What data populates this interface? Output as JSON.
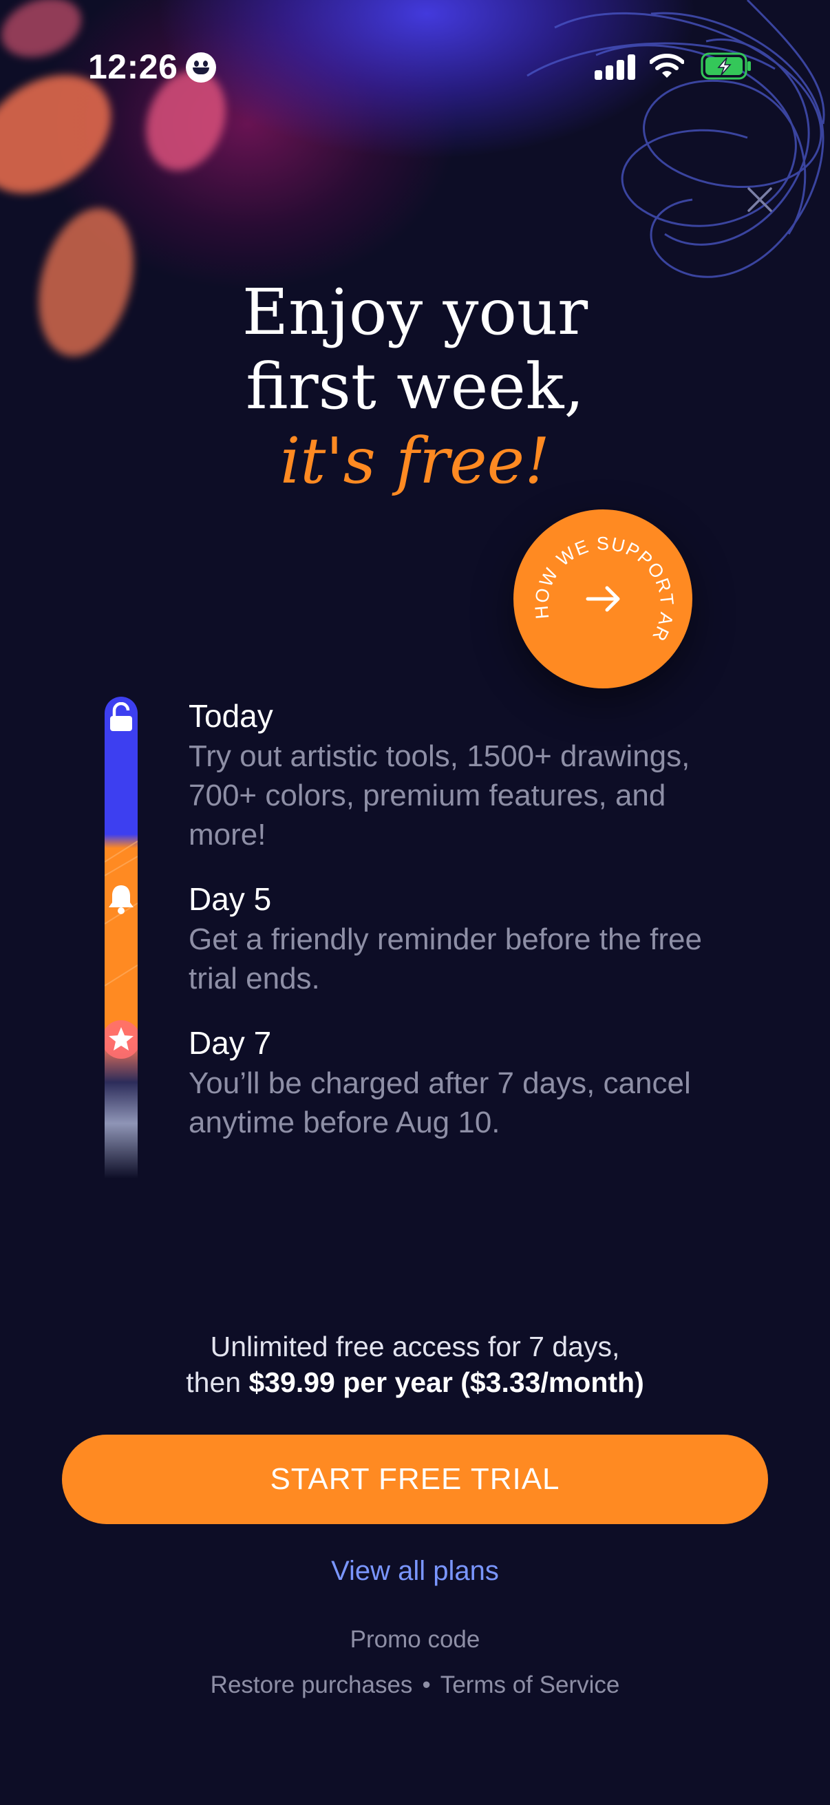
{
  "status_bar": {
    "time": "12:26"
  },
  "headline": {
    "line1": "Enjoy your",
    "line2": "first week,",
    "line3": "it's free!"
  },
  "support_badge": {
    "text": "HOW WE SUPPORT ARTISTS"
  },
  "timeline": [
    {
      "icon": "unlock-icon",
      "title": "Today",
      "description": "Try out artistic tools, 1500+ drawings, 700+ colors, premium features, and more!"
    },
    {
      "icon": "bell-icon",
      "title": "Day 5",
      "description": "Get a friendly reminder before the free trial ends."
    },
    {
      "icon": "star-icon",
      "title": "Day 7",
      "description": "You’ll be charged after 7 days, cancel anytime before Aug 10."
    }
  ],
  "pricing": {
    "line1": "Unlimited free access for 7 days,",
    "line2_prefix": "then ",
    "line2_bold": "$39.99 per year ($3.33/month)"
  },
  "cta": {
    "label": "START FREE TRIAL"
  },
  "links": {
    "view_all_plans": "View all plans",
    "promo_code": "Promo code",
    "restore_purchases": "Restore purchases",
    "separator": "•",
    "terms": "Terms of Service"
  },
  "colors": {
    "background": "#0d0d26",
    "accent_orange": "#ff8a22",
    "accent_blue": "#3d3ff0",
    "link_blue": "#7a96ff",
    "muted_text": "#8e8fa6"
  }
}
